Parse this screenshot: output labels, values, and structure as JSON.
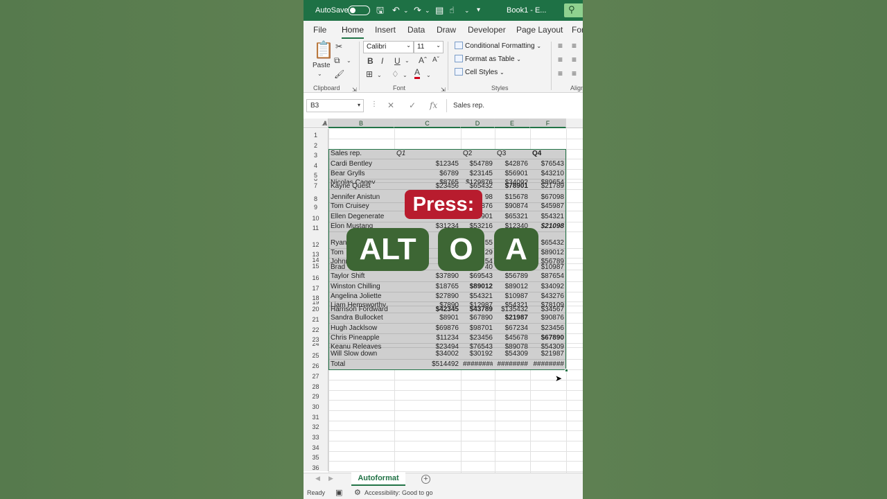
{
  "titlebar": {
    "autosave_label": "AutoSave",
    "book_title": "Book1  -  E...",
    "icons": [
      "save-icon",
      "undo-icon",
      "redo-icon",
      "chart-icon",
      "touch-icon",
      "customize-icon",
      "search-icon"
    ]
  },
  "tabs": [
    {
      "label": "File"
    },
    {
      "label": "Home"
    },
    {
      "label": "Insert"
    },
    {
      "label": "Data"
    },
    {
      "label": "Draw"
    },
    {
      "label": "Developer"
    },
    {
      "label": "Page Layout"
    },
    {
      "label": "For"
    }
  ],
  "ribbon": {
    "paste_label": "Paste",
    "clipboard_label": "Clipboard",
    "font_name": "Calibri",
    "font_size": "11",
    "bold": "B",
    "italic": "I",
    "underline": "U",
    "font_group_label": "Font",
    "conditional_formatting": "Conditional Formatting",
    "format_as_table": "Format as Table",
    "cell_styles": "Cell Styles",
    "styles_label": "Styles",
    "alignment_label": "Align",
    "accent_color": "#217346"
  },
  "formula_bar": {
    "name_box": "B3",
    "fx": "fx",
    "content": "Sales rep."
  },
  "columns": [
    "A",
    "B",
    "C",
    "D",
    "E",
    "F"
  ],
  "rows": [
    "1",
    "2",
    "3",
    "4",
    "5",
    "6",
    "7",
    "8",
    "9",
    "10",
    "11",
    "12",
    "13",
    "14",
    "15",
    "16",
    "17",
    "18",
    "19",
    "20",
    "21",
    "22",
    "23",
    "24",
    "25",
    "26",
    "27",
    "28",
    "29",
    "30",
    "31",
    "32",
    "33",
    "34",
    "35",
    "36"
  ],
  "table": {
    "headers": [
      "Sales rep.",
      "Q1",
      "Q2",
      "Q3",
      "Q4"
    ],
    "rows": [
      {
        "name": "Cardi Bentley",
        "q1": "$12345",
        "q2": "$54789",
        "q3": "$42876",
        "q4": "$76543"
      },
      {
        "name": "Bear Grylls",
        "q1": "$6789",
        "q2": "$23145",
        "q3": "$56901",
        "q4": "$43210"
      },
      {
        "name": "Nicolas Cagey",
        "q1": "$8765",
        "q2": "$129876",
        "q3": "$34092",
        "q4": "$89654"
      },
      {
        "name": "Kayne Quest",
        "q1": "$23456",
        "q2": "$65432",
        "q3": "$78901",
        "q4": "$21789"
      },
      {
        "name": "Jennifer Anistun",
        "q1": "",
        "q2": "98",
        "q3": "$15678",
        "q4": "$67098"
      },
      {
        "name": "Tom Cruisey",
        "q1": "",
        "q2": "876",
        "q3": "$90874",
        "q4": "$45987"
      },
      {
        "name": "Ellen Degenerate",
        "q1": "$7821",
        "q2": "$76901",
        "q3": "$65321",
        "q4": "$54321"
      },
      {
        "name": "Elon Mustang",
        "q1": "$31234",
        "q2": "$53216",
        "q3": "$12340",
        "q4": "$21098"
      },
      {
        "name": "Ryan",
        "q1": "$",
        "q2": "55",
        "q3": "",
        "q4": "$65432"
      },
      {
        "name": "Tom",
        "q1": "",
        "q2": "29",
        "q3": "",
        "q4": "$89012"
      },
      {
        "name": "Johnn",
        "q1": "$",
        "q2": "54",
        "q3": "",
        "q4": "$56789"
      },
      {
        "name": "Brad",
        "q1": "$",
        "q2": "40",
        "q3": "",
        "q4": "$10987"
      },
      {
        "name": "Taylor Shift",
        "q1": "$37890",
        "q2": "$69543",
        "q3": "$56789",
        "q4": "$87654"
      },
      {
        "name": "Winston Chilling",
        "q1": "$18765",
        "q2": "$89012",
        "q3": "$89012",
        "q4": "$34092"
      },
      {
        "name": "Angelina Joliette",
        "q1": "$27890",
        "q2": "$54321",
        "q3": "$10987",
        "q4": "$43276"
      },
      {
        "name": "Liam Hemsworthy",
        "q1": "$7890",
        "q2": "$12987",
        "q3": "$54321",
        "q4": "$78109"
      },
      {
        "name": "Harrison Fordward",
        "q1": "$42345",
        "q2": "$43789",
        "q3": "$135432",
        "q4": "$34567"
      },
      {
        "name": "Sandra Bullocket",
        "q1": "$8901",
        "q2": "$67890",
        "q3": "$21987",
        "q4": "$90876"
      },
      {
        "name": "Hugh Jacklsow",
        "q1": "$69876",
        "q2": "$98701",
        "q3": "$67234",
        "q4": "$23456"
      },
      {
        "name": "Chris Pineapple",
        "q1": "$11234",
        "q2": "$23456",
        "q3": "$45678",
        "q4": "$67890"
      },
      {
        "name": "Keanu Releaves",
        "q1": "$23494",
        "q2": "$76543",
        "q3": "$89078",
        "q4": "$54309"
      },
      {
        "name": "Will Slow down",
        "q1": "$34002",
        "q2": "$30192",
        "q3": "$54309",
        "q4": "$21987"
      }
    ],
    "total": {
      "name": "Total",
      "q1": "$514492",
      "q2": "########",
      "q3": "########",
      "q4": "########"
    }
  },
  "overlay": {
    "press": "Press:",
    "keys": [
      "ALT",
      "O",
      "A"
    ],
    "press_color": "#b81c2e",
    "key_color": "#3d6634"
  },
  "sheet_tab": "Autoformat",
  "status": {
    "ready": "Ready",
    "accessibility": "Accessibility: Good to go"
  }
}
